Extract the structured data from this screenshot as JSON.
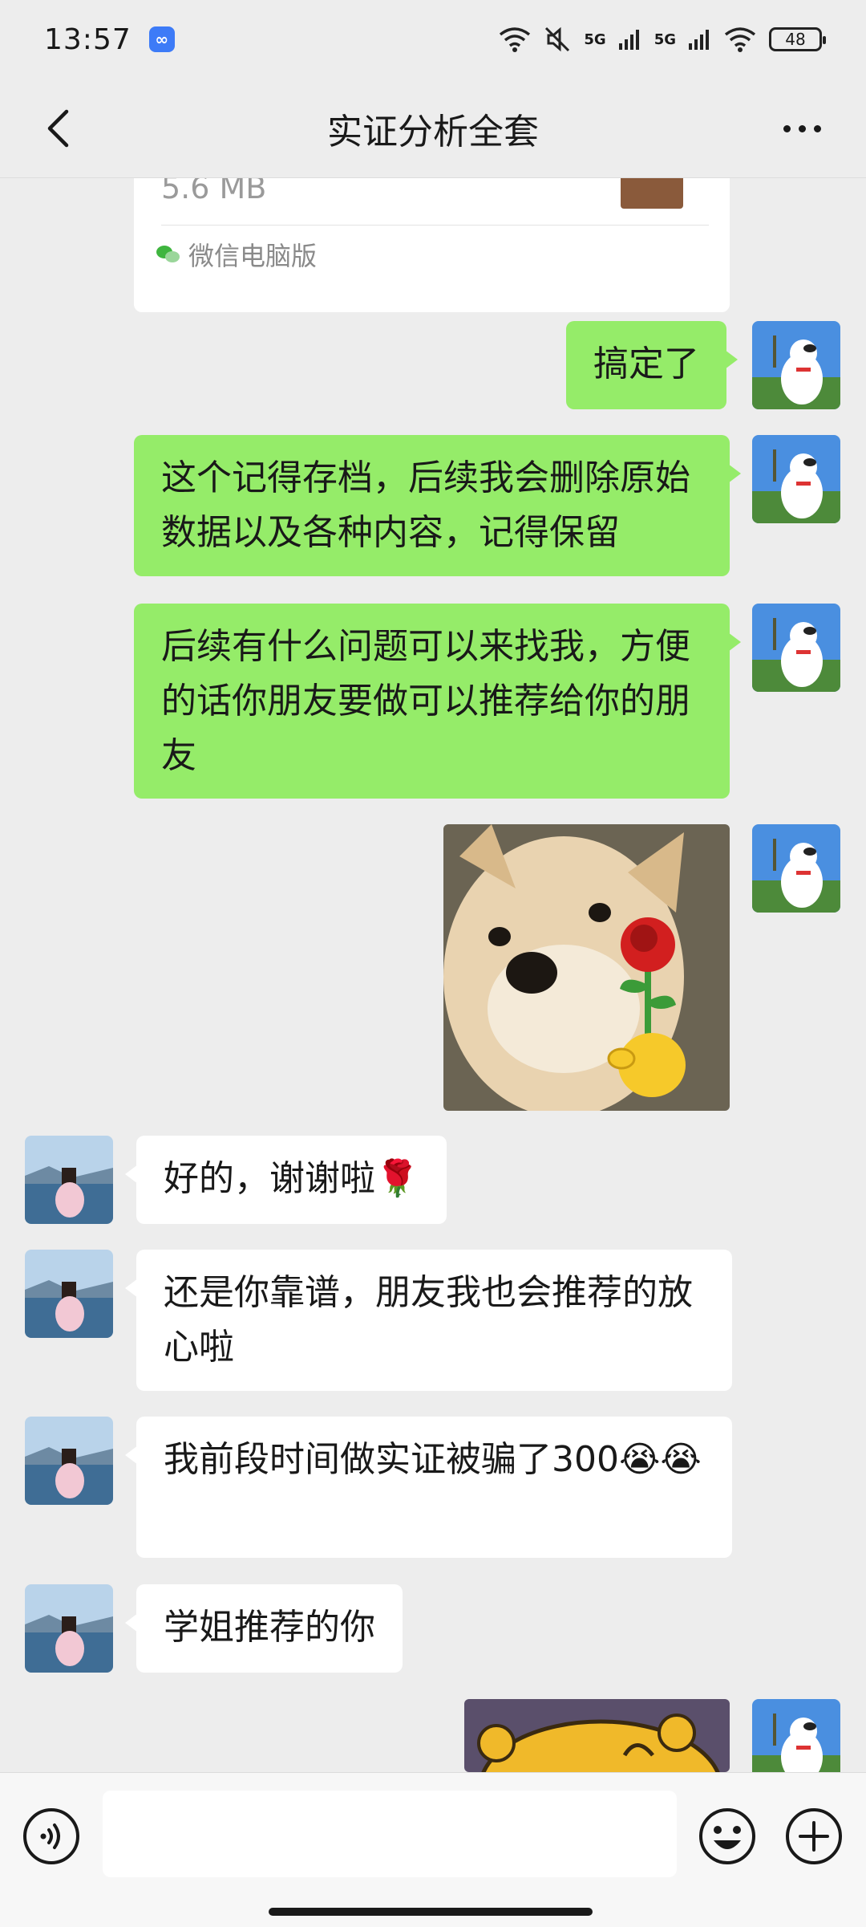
{
  "status_bar": {
    "time": "13:57",
    "network_1": "5G",
    "network_2": "5G",
    "battery": "48"
  },
  "header": {
    "title": "实证分析全套"
  },
  "file_card": {
    "size": "5.6 MB",
    "source": "微信电脑版"
  },
  "messages": [
    {
      "side": "me",
      "text": "搞定了"
    },
    {
      "side": "me",
      "text": "这个记得存档，后续我会删除原始数据以及各种内容，记得保留"
    },
    {
      "side": "me",
      "text": "后续有什么问题可以来找我，方便的话你朋友要做可以推荐给你的朋友"
    },
    {
      "side": "me",
      "type": "sticker",
      "icon": "shiba-dog-with-rose-sticker"
    },
    {
      "side": "other",
      "text": "好的，谢谢啦🌹"
    },
    {
      "side": "other",
      "text": "还是你靠谱，朋友我也会推荐的放心啦"
    },
    {
      "side": "other",
      "text": "我前段时间做实证被骗了300😭😭"
    },
    {
      "side": "other",
      "text": "学姐推荐的你"
    },
    {
      "side": "me",
      "type": "sticker",
      "icon": "cartoon-bear-sticker"
    }
  ],
  "colors": {
    "background": "#ededed",
    "my_bubble": "#95ec69",
    "other_bubble": "#ffffff"
  },
  "icons": {
    "back": "back-chevron-icon",
    "more": "more-dots-icon",
    "voice": "voice-icon",
    "emoji": "emoji-icon",
    "plus": "plus-icon"
  }
}
